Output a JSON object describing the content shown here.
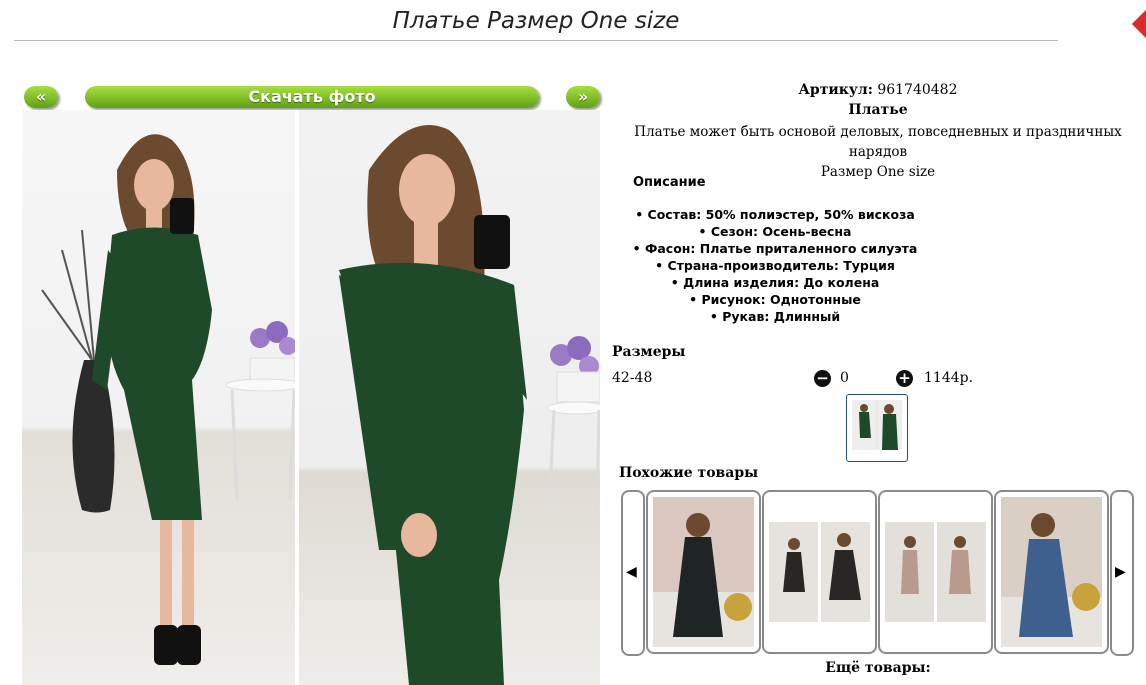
{
  "page": {
    "title": "Платье Размер One size"
  },
  "gallery": {
    "prev_label": "«",
    "download_label": "Скачать фото",
    "next_label": "»"
  },
  "product": {
    "article_label": "Артикул:",
    "article_value": "961740482",
    "name": "Платье",
    "summary_line1": "Платье может быть основой деловых, повседневных и праздничных нарядов",
    "summary_line2": "Размер One size"
  },
  "description": {
    "title": "Описание",
    "features": [
      "Состав: 50% полиэстер, 50% вискоза",
      "Сезон: Осень-весна",
      "Фасон: Платье приталенного силуэта",
      "Страна-производитель: Турция",
      "Длина изделия: До колена",
      "Рисунок: Однотонные",
      "Рукав: Длинный"
    ]
  },
  "sizes": {
    "title": "Размеры",
    "rows": [
      {
        "label": "42-48",
        "quantity": "0",
        "price": "1144р."
      }
    ]
  },
  "similar": {
    "title": "Похожие товары",
    "left_arrow": "◀",
    "right_arrow": "▶",
    "cards": [
      {
        "dress_color": "#1f2424",
        "bg": "#d9c7c0"
      },
      {
        "dress_color": "#2a2626",
        "bg": "#e6e3df"
      },
      {
        "dress_color": "#b99a8d",
        "bg": "#e3e0dc"
      },
      {
        "dress_color": "#3f5f8e",
        "bg": "#d9cfc4"
      }
    ]
  },
  "more": {
    "title": "Ещё товары:"
  },
  "colors": {
    "button_green": "#6fb01f",
    "dress_green": "#1f4a2a",
    "thumb_border": "#2d4f6c"
  }
}
